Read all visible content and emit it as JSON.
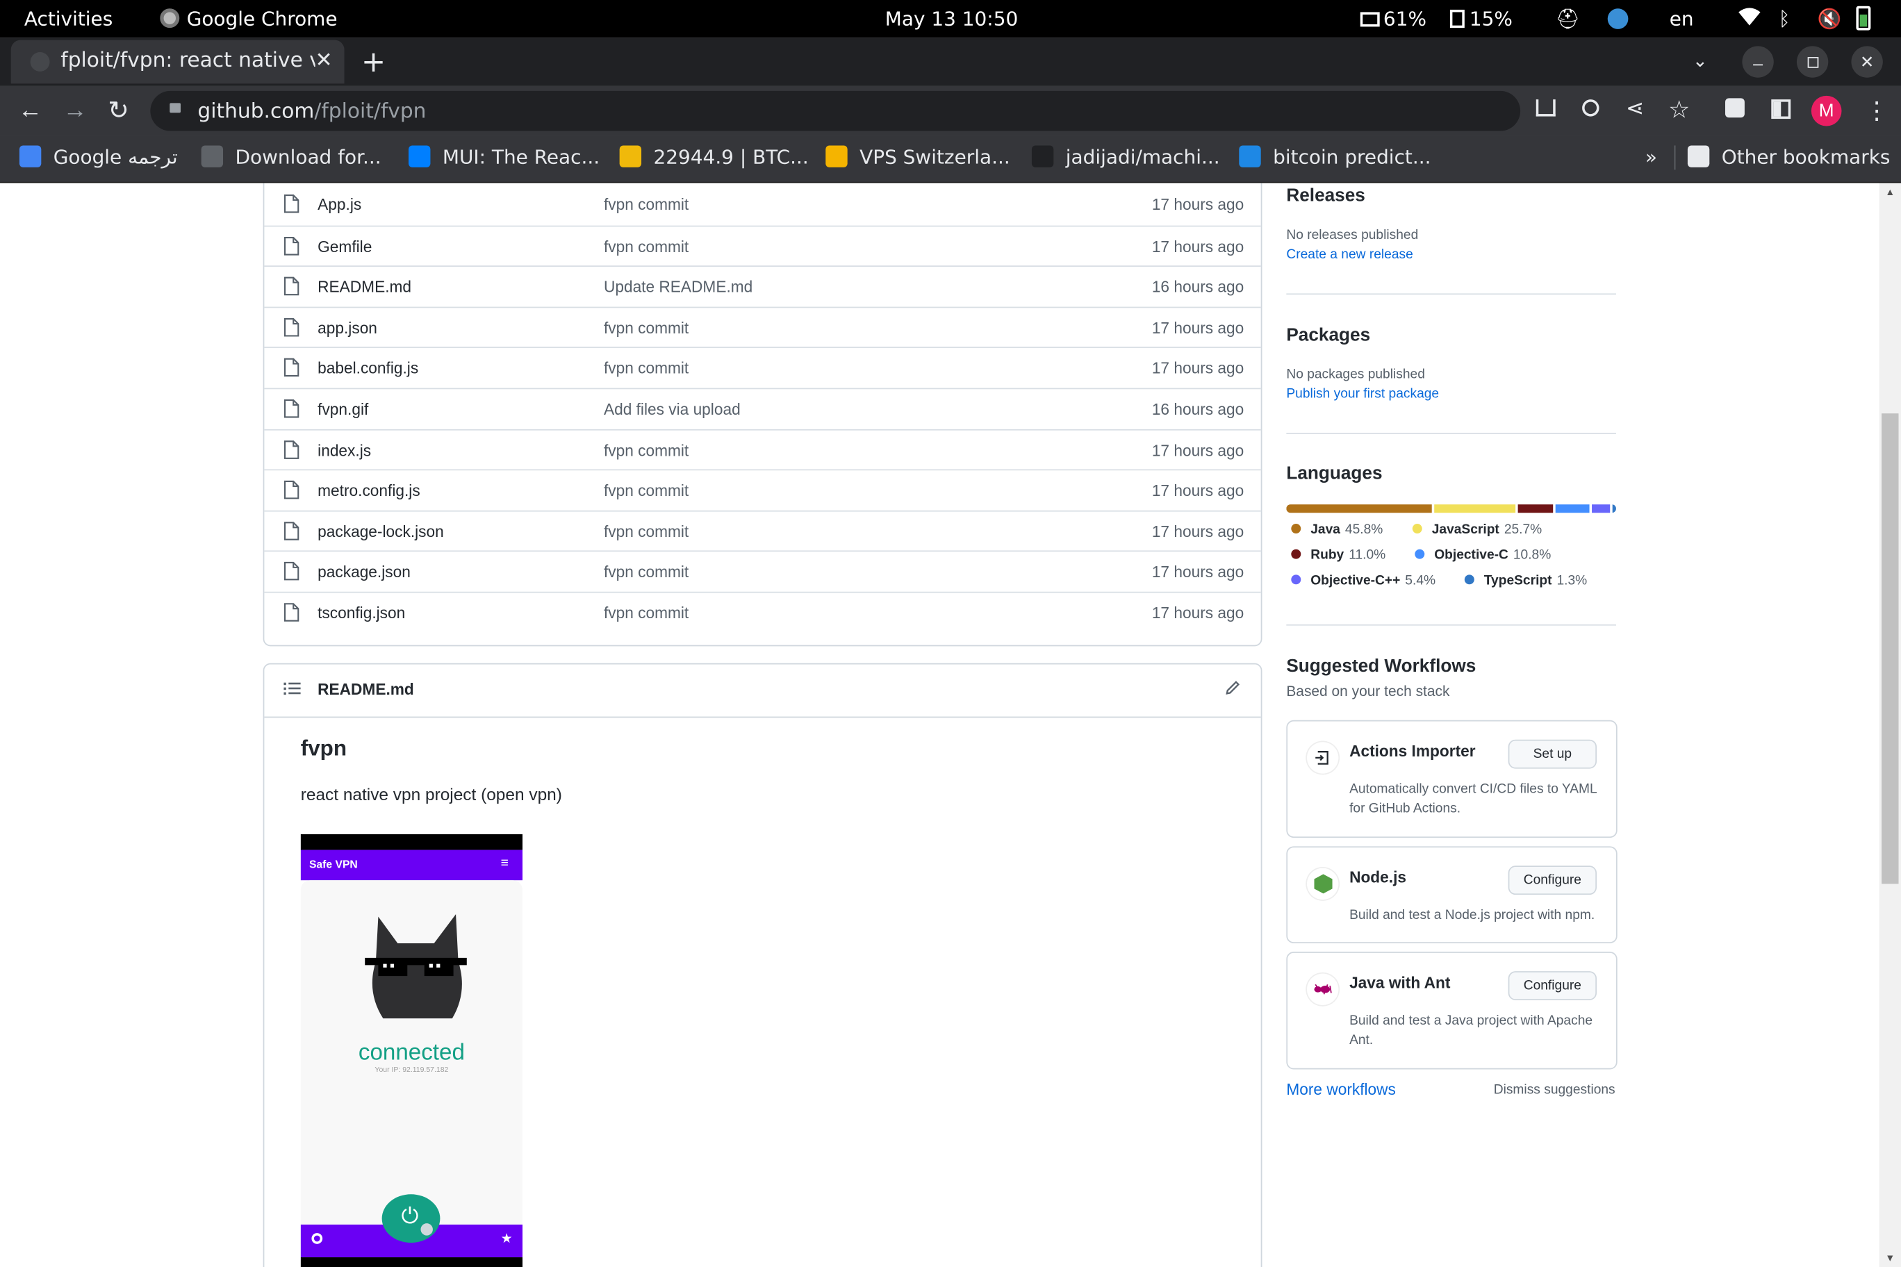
{
  "system_bar": {
    "activities": "Activities",
    "app": "Google Chrome",
    "datetime": "May 13  10:50",
    "battery1": "61%",
    "battery2": "15%",
    "lang": "en"
  },
  "browser": {
    "tab_title": "fploit/fvpn: react native v",
    "url_host": "github.com",
    "url_path": "/fploit/fvpn",
    "profile_initial": "M",
    "bookmarks": [
      {
        "label": "Google ترجمه",
        "color": "#4285f4"
      },
      {
        "label": "Download for...",
        "color": "#5f6368"
      },
      {
        "label": "MUI: The Reac...",
        "color": "#007fff"
      },
      {
        "label": "22944.9 | BTC...",
        "color": "#f0b90b"
      },
      {
        "label": "VPS Switzerla...",
        "color": "#f5b400"
      },
      {
        "label": "jadijadi/machi...",
        "color": "#202124"
      },
      {
        "label": "bitcoin predict...",
        "color": "#1e88e5"
      }
    ],
    "bookmarks_more": "»",
    "other_bookmarks": "Other bookmarks"
  },
  "files": [
    {
      "name": "App.js",
      "message": "fvpn commit",
      "age": "17 hours ago"
    },
    {
      "name": "Gemfile",
      "message": "fvpn commit",
      "age": "17 hours ago"
    },
    {
      "name": "README.md",
      "message": "Update README.md",
      "age": "16 hours ago"
    },
    {
      "name": "app.json",
      "message": "fvpn commit",
      "age": "17 hours ago"
    },
    {
      "name": "babel.config.js",
      "message": "fvpn commit",
      "age": "17 hours ago"
    },
    {
      "name": "fvpn.gif",
      "message": "Add files via upload",
      "age": "16 hours ago"
    },
    {
      "name": "index.js",
      "message": "fvpn commit",
      "age": "17 hours ago"
    },
    {
      "name": "metro.config.js",
      "message": "fvpn commit",
      "age": "17 hours ago"
    },
    {
      "name": "package-lock.json",
      "message": "fvpn commit",
      "age": "17 hours ago"
    },
    {
      "name": "package.json",
      "message": "fvpn commit",
      "age": "17 hours ago"
    },
    {
      "name": "tsconfig.json",
      "message": "fvpn commit",
      "age": "17 hours ago"
    }
  ],
  "readme": {
    "filename": "README.md",
    "title": "fvpn",
    "description": "react native vpn project (open vpn)",
    "preview": {
      "app_name": "Safe VPN",
      "status": "connected",
      "ip": "Your IP: 92.119.57.182"
    }
  },
  "sidebar": {
    "releases": {
      "title": "Releases",
      "status": "No releases published",
      "link": "Create a new release"
    },
    "packages": {
      "title": "Packages",
      "status": "No packages published",
      "link": "Publish your first package"
    },
    "languages": {
      "title": "Languages",
      "items": [
        {
          "name": "Java",
          "percent": "45.8%",
          "value": 45.8,
          "color": "#b07219"
        },
        {
          "name": "JavaScript",
          "percent": "25.7%",
          "value": 25.7,
          "color": "#f1e05a"
        },
        {
          "name": "Ruby",
          "percent": "11.0%",
          "value": 11.0,
          "color": "#701516"
        },
        {
          "name": "Objective-C",
          "percent": "10.8%",
          "value": 10.8,
          "color": "#438eff"
        },
        {
          "name": "Objective-C++",
          "percent": "5.4%",
          "value": 5.4,
          "color": "#6866fb"
        },
        {
          "name": "TypeScript",
          "percent": "1.3%",
          "value": 1.3,
          "color": "#3178c6"
        }
      ]
    },
    "workflows": {
      "title": "Suggested Workflows",
      "subtitle": "Based on your tech stack",
      "items": [
        {
          "name": "Actions Importer",
          "button": "Set up",
          "description": "Automatically convert CI/CD files to YAML for GitHub Actions.",
          "icon": "actions-importer-icon"
        },
        {
          "name": "Node.js",
          "button": "Configure",
          "description": "Build and test a Node.js project with npm.",
          "icon": "nodejs-icon"
        },
        {
          "name": "Java with Ant",
          "button": "Configure",
          "description": "Build and test a Java project with Apache Ant.",
          "icon": "ant-icon"
        }
      ],
      "more": "More workflows",
      "dismiss": "Dismiss suggestions"
    }
  }
}
